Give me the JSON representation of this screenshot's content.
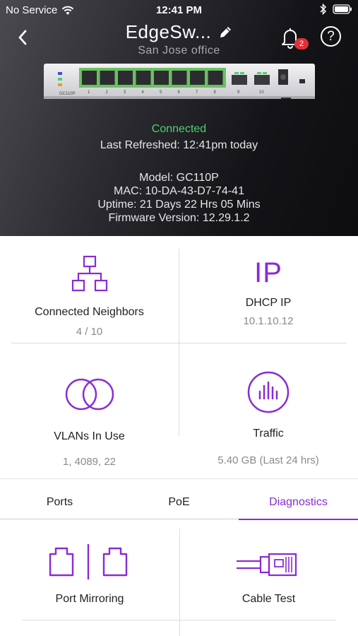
{
  "status_bar": {
    "carrier": "No Service",
    "time": "12:41 PM"
  },
  "header": {
    "title": "EdgeSw...",
    "subtitle": "San Jose  office",
    "notification_count": "2",
    "help_label": "?"
  },
  "device": {
    "model_label": "GC110P",
    "port_numbers": [
      "1",
      "2",
      "3",
      "4",
      "5",
      "6",
      "7",
      "8"
    ],
    "sfp_numbers": [
      "9",
      "10"
    ],
    "status": "Connected",
    "last_refreshed": "Last Refreshed: 12:41pm today",
    "model": "Model: GC110P",
    "mac": "MAC: 10-DA-43-D7-74-41",
    "uptime": "Uptime: 21 Days 22 Hrs 05 Mins",
    "firmware": "Firmware Version: 12.29.1.2"
  },
  "tiles": {
    "neighbors": {
      "label": "Connected Neighbors",
      "value": "4 / 10"
    },
    "dhcp": {
      "icon_text": "IP",
      "label": "DHCP IP",
      "value": "10.1.10.12"
    },
    "vlans": {
      "label": "VLANs In Use",
      "value": "1, 4089, 22"
    },
    "traffic": {
      "label": "Traffic",
      "value": "5.40 GB (Last 24 hrs)"
    }
  },
  "tabs": [
    {
      "label": "Ports"
    },
    {
      "label": "PoE"
    },
    {
      "label": "Diagnostics"
    }
  ],
  "diagnostics": {
    "port_mirroring": "Port Mirroring",
    "cable_test": "Cable Test"
  },
  "colors": {
    "accent": "#8a2bd6",
    "connected": "#4fd06b",
    "badge": "#e0303a"
  }
}
